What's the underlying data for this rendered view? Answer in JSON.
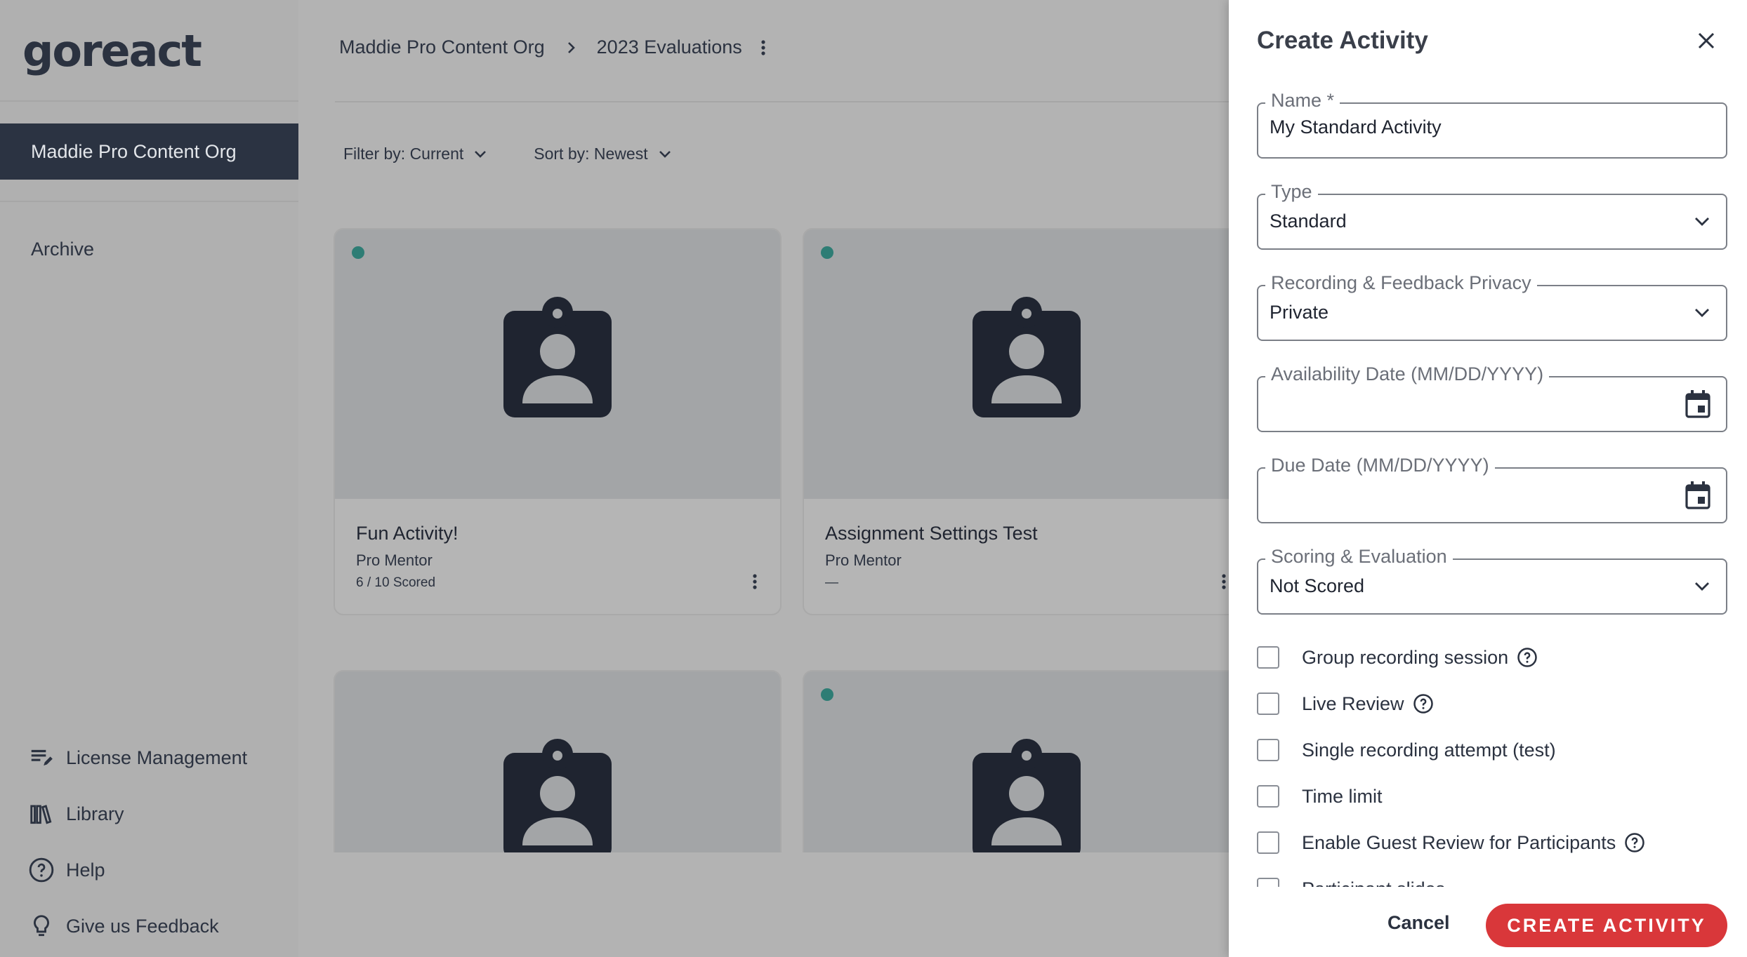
{
  "app": {
    "logo": "goreact"
  },
  "sidebar": {
    "org_label": "Maddie Pro Content Org",
    "archive_label": "Archive",
    "links": [
      {
        "label": "License Management",
        "icon": "license-list-icon"
      },
      {
        "label": "Library",
        "icon": "library-books-icon"
      },
      {
        "label": "Help",
        "icon": "help-circle-icon"
      },
      {
        "label": "Give us Feedback",
        "icon": "lightbulb-icon"
      }
    ]
  },
  "main": {
    "breadcrumb": {
      "org": "Maddie Pro Content Org",
      "folder": "2023 Evaluations"
    },
    "filters": {
      "filter_label": "Filter by: Current",
      "sort_label": "Sort by: Newest"
    },
    "cards": [
      {
        "title": "Fun Activity!",
        "subtitle": "Pro Mentor",
        "meta": "6 / 10 Scored"
      },
      {
        "title": "Assignment Settings Test",
        "subtitle": "Pro Mentor",
        "meta": "—"
      }
    ]
  },
  "panel": {
    "title": "Create Activity",
    "fields": {
      "name": {
        "label": "Name *",
        "value": "My Standard Activity"
      },
      "type": {
        "label": "Type",
        "value": "Standard"
      },
      "privacy": {
        "label": "Recording & Feedback Privacy",
        "value": "Private"
      },
      "availability": {
        "label": "Availability Date (MM/DD/YYYY)"
      },
      "due": {
        "label": "Due Date (MM/DD/YYYY)"
      },
      "scoring": {
        "label": "Scoring & Evaluation",
        "value": "Not Scored"
      }
    },
    "checkboxes": [
      {
        "label": "Group recording session",
        "help": true
      },
      {
        "label": "Live Review",
        "help": true
      },
      {
        "label": "Single recording attempt (test)",
        "help": false
      },
      {
        "label": "Time limit",
        "help": false
      },
      {
        "label": "Enable Guest Review for Participants",
        "help": true
      },
      {
        "label": "Participant slides",
        "help": false
      }
    ],
    "cancel_label": "Cancel",
    "create_label": "CREATE ACTIVITY"
  },
  "colors": {
    "sidebar_active": "#2b3342",
    "accent_red": "#d9373a",
    "status_dot": "#2e7d75",
    "icon_dark": "#1f2430"
  }
}
